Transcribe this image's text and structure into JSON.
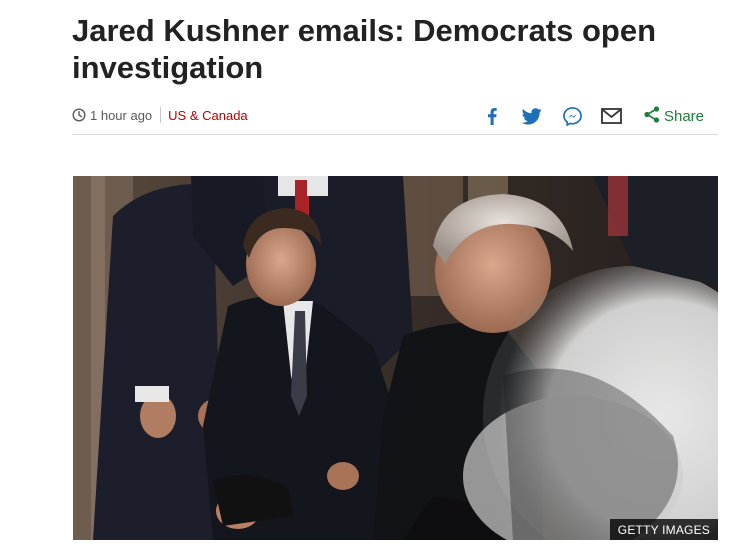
{
  "article": {
    "headline": "Jared Kushner emails: Democrats open investigation",
    "timestamp": "1 hour ago",
    "section": "US & Canada"
  },
  "share": {
    "label": "Share",
    "icons": [
      "facebook-icon",
      "twitter-icon",
      "messenger-icon",
      "email-icon",
      "share-icon"
    ],
    "colors": {
      "social": "#1d6fb8",
      "share": "#1a7f37",
      "section": "#b80000"
    }
  },
  "image": {
    "credit": "GETTY IMAGES"
  }
}
